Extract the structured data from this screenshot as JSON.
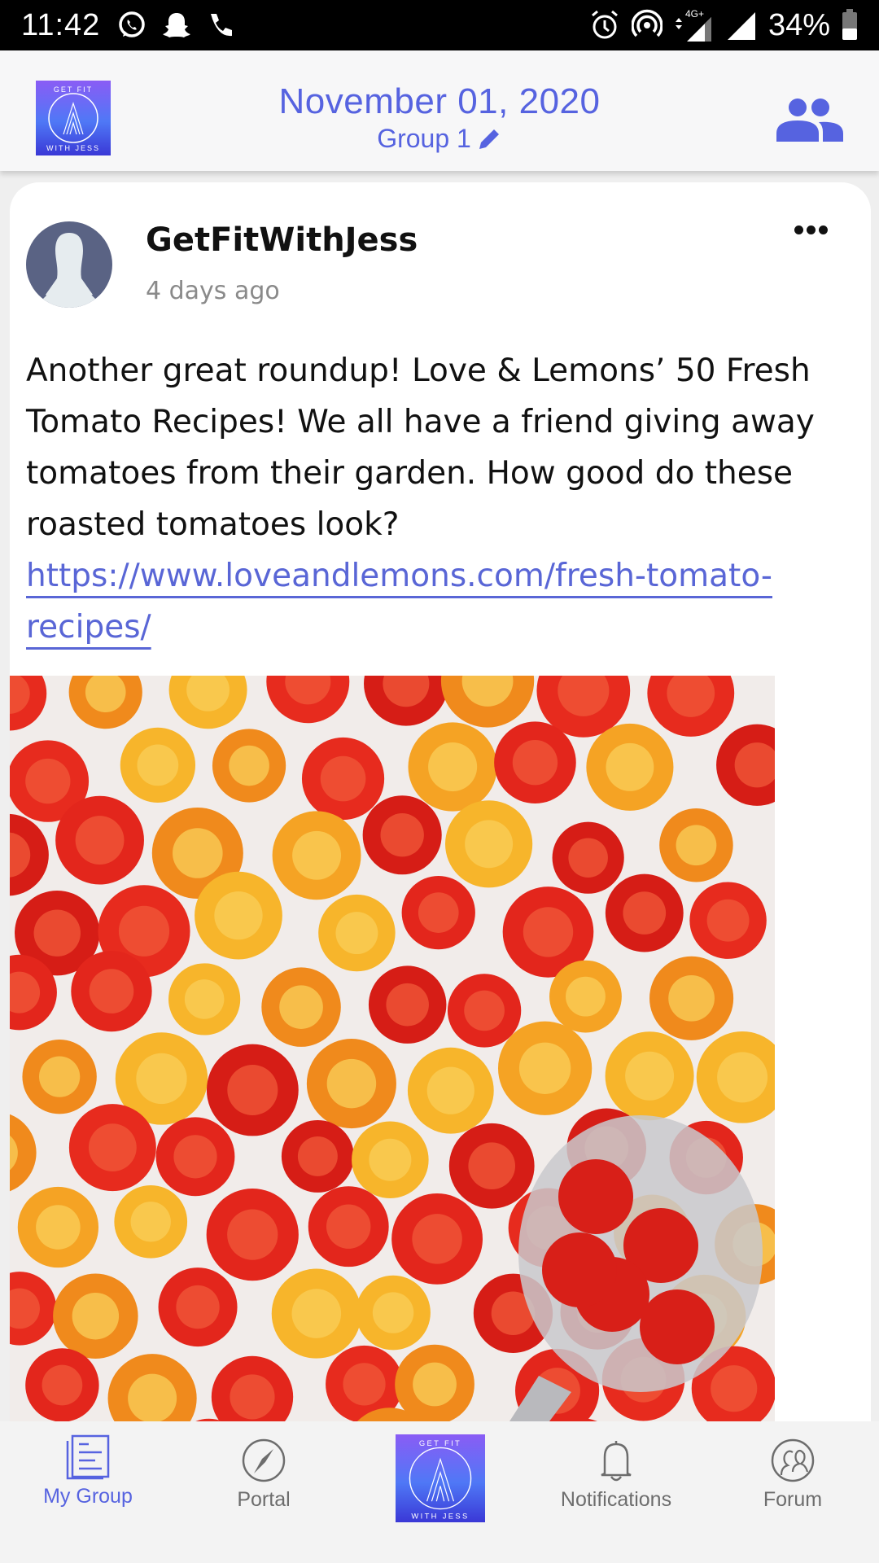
{
  "status_bar": {
    "time": "11:42",
    "left_icons": [
      "whatsapp-icon",
      "snapchat-icon",
      "phone-icon"
    ],
    "right_icons": [
      "alarm-icon",
      "hotspot-icon",
      "signal-4g-icon",
      "signal-icon",
      "battery-icon"
    ],
    "network_label": "4G+",
    "battery": "34%"
  },
  "header": {
    "logo_text_top": "GET FIT",
    "logo_text_bottom": "WITH JESS",
    "title": "November 01, 2020",
    "subtitle": "Group 1",
    "accent_color": "#5663e0"
  },
  "post": {
    "author": "GetFitWithJess",
    "time_ago": "4 days ago",
    "body": "Another great roundup! Love & Lemons’ 50 Fresh Tomato Recipes! We all have a friend giving away tomatoes from their garden. How good do these roasted tomatoes look?",
    "link": "https://www.loveandlemons.com/fresh-tomato-recipes/",
    "image_alt": "Roasted red and yellow cherry tomatoes with thyme and a spoon"
  },
  "bottom_nav": {
    "items": [
      {
        "label": "My Group",
        "icon": "document-icon",
        "active": true
      },
      {
        "label": "Portal",
        "icon": "compass-icon",
        "active": false
      },
      {
        "label": "",
        "icon": "app-logo",
        "active": false
      },
      {
        "label": "Notifications",
        "icon": "bell-icon",
        "active": false
      },
      {
        "label": "Forum",
        "icon": "forum-icon",
        "active": false
      }
    ]
  }
}
